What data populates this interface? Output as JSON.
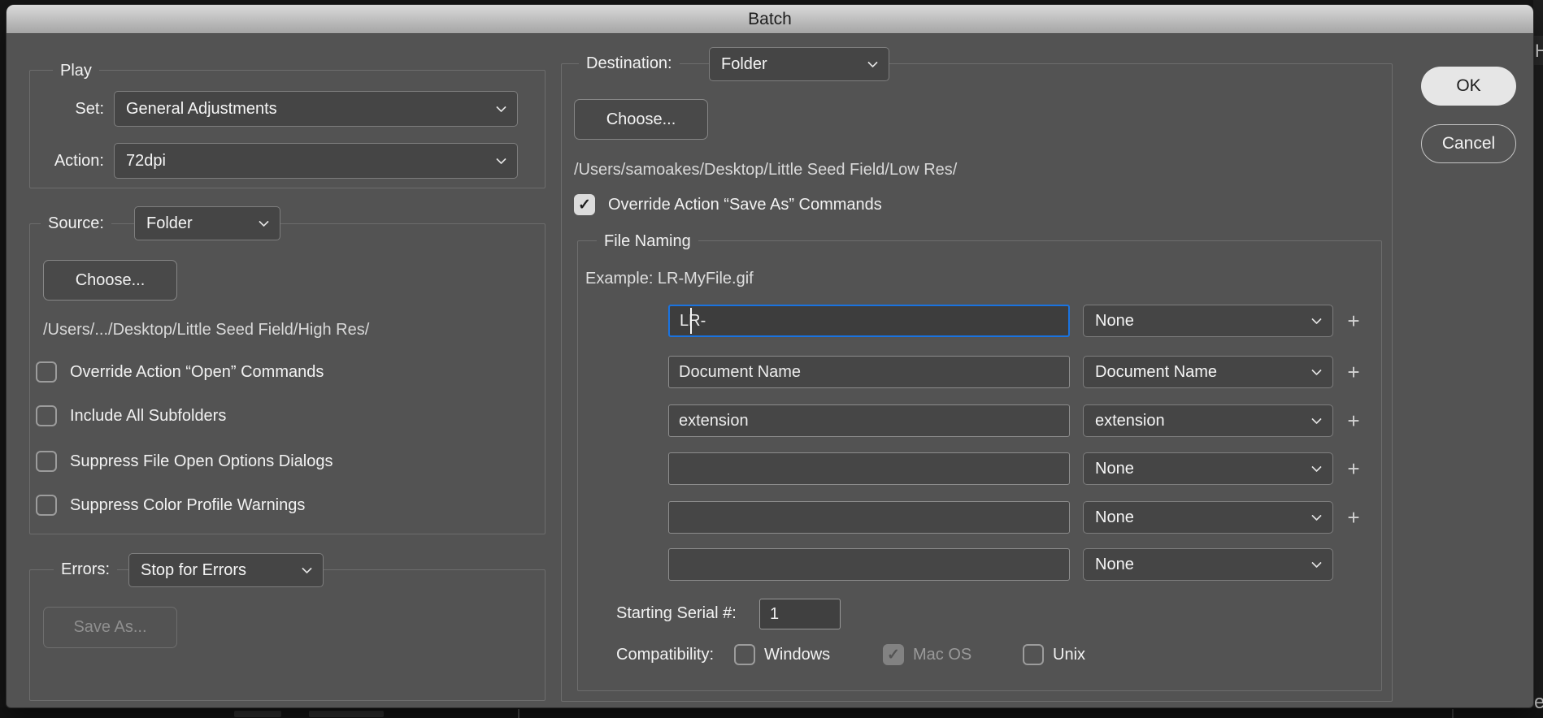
{
  "window": {
    "title": "Batch"
  },
  "colors": {
    "dialog_bg": "#535353",
    "focus_accent": "#1a73e0",
    "titlebar_top": "#dadada",
    "titlebar_bottom": "#a5a5a5",
    "ok_button_bg": "#e6e6e6"
  },
  "icons": {
    "chevron_down": "⌄",
    "plus": "+",
    "check": "✓"
  },
  "play": {
    "legend": "Play",
    "set_label": "Set:",
    "set_value": "General Adjustments",
    "action_label": "Action:",
    "action_value": "72dpi"
  },
  "source": {
    "label": "Source:",
    "value": "Folder",
    "choose_label": "Choose...",
    "path": "/Users/.../Desktop/Little Seed Field/High Res/",
    "checkboxes": [
      {
        "label": "Override Action “Open” Commands",
        "checked": false
      },
      {
        "label": "Include All Subfolders",
        "checked": false
      },
      {
        "label": "Suppress File Open Options Dialogs",
        "checked": false
      },
      {
        "label": "Suppress Color Profile Warnings",
        "checked": false
      }
    ]
  },
  "errors": {
    "label": "Errors:",
    "value": "Stop for Errors",
    "save_as_label": "Save As..."
  },
  "destination": {
    "label": "Destination:",
    "value": "Folder",
    "choose_label": "Choose...",
    "path": "/Users/samoakes/Desktop/Little Seed Field/Low Res/",
    "override_label": "Override Action “Save As” Commands",
    "override_checked": true
  },
  "file_naming": {
    "legend": "File Naming",
    "example": "Example: LR-MyFile.gif",
    "rows": [
      {
        "value": "LR-",
        "option": "None",
        "focused": true,
        "has_plus": true
      },
      {
        "value": "Document Name",
        "option": "Document Name",
        "focused": false,
        "has_plus": true
      },
      {
        "value": "extension",
        "option": "extension",
        "focused": false,
        "has_plus": true
      },
      {
        "value": "",
        "option": "None",
        "focused": false,
        "has_plus": true
      },
      {
        "value": "",
        "option": "None",
        "focused": false,
        "has_plus": true
      },
      {
        "value": "",
        "option": "None",
        "focused": false,
        "has_plus": false
      }
    ],
    "serial_label": "Starting Serial #:",
    "serial_value": "1",
    "compat_label": "Compatibility:",
    "compat": [
      {
        "label": "Windows",
        "checked": false,
        "disabled": false
      },
      {
        "label": "Mac OS",
        "checked": true,
        "disabled": true
      },
      {
        "label": "Unix",
        "checked": false,
        "disabled": false
      }
    ]
  },
  "actions": {
    "ok": "OK",
    "cancel": "Cancel"
  },
  "background": {
    "top_right_fragment": "H",
    "bottom_right_fragment": "e"
  }
}
